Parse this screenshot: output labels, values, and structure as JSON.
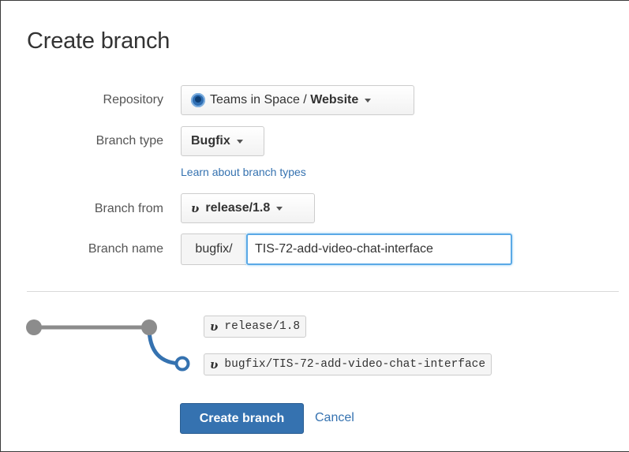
{
  "dialog": {
    "title": "Create branch"
  },
  "form": {
    "repository": {
      "label": "Repository",
      "project": "Teams in Space",
      "separator": " / ",
      "repo": "Website"
    },
    "branch_type": {
      "label": "Branch type",
      "value": "Bugfix",
      "help_link": "Learn about branch types"
    },
    "branch_from": {
      "label": "Branch from",
      "value": "release/1.8"
    },
    "branch_name": {
      "label": "Branch name",
      "prefix": "bugfix/",
      "value": "TIS-72-add-video-chat-interface"
    }
  },
  "diagram": {
    "source_branch": "release/1.8",
    "new_branch": "bugfix/TIS-72-add-video-chat-interface",
    "line_color": "#8c8c8c",
    "new_branch_color": "#3572b0"
  },
  "actions": {
    "create_label": "Create branch",
    "cancel_label": "Cancel"
  },
  "icons": {
    "repo": "repository-avatar-icon",
    "branch": "branch-icon",
    "caret": "chevron-down-icon"
  }
}
